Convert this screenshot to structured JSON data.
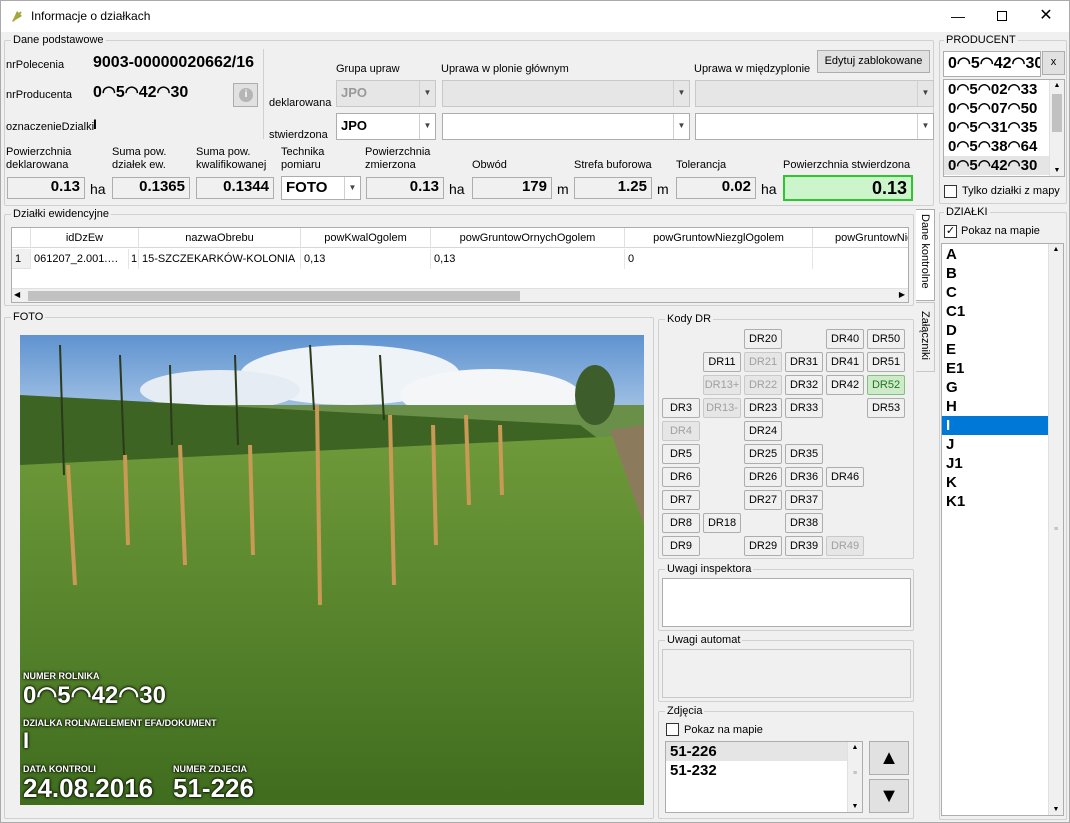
{
  "window": {
    "title": "Informacje o działkach"
  },
  "dane": {
    "title": "Dane podstawowe",
    "nrPolecenia_label": "nrPolecenia",
    "nrPolecenia": "9003-00000020662/16",
    "nrProducenta_label": "nrProducenta",
    "nrProducenta": "0◠5◠42◠30",
    "oznaczenie_label": "oznaczenieDzialki",
    "oznaczenie": "I",
    "grupa_upraw": "Grupa upraw",
    "uprawa_glowna": "Uprawa w plonie głównym",
    "uprawa_miedzy": "Uprawa w międzyplonie",
    "edit_btn": "Edytuj zablokowane",
    "deklarowana": "deklarowana",
    "stwierdzona": "stwierdzona",
    "grupa_dekl": "JPO",
    "grupa_stw": "JPO"
  },
  "measures": {
    "pow_dekl_label": "Powierzchnia deklarowana",
    "pow_dekl": "0.13",
    "suma_ew_label": "Suma pow. działek ew.",
    "suma_ew": "0.1365",
    "suma_kwal_label": "Suma pow. kwalifikowanej",
    "suma_kwal": "0.1344",
    "technika_label": "Technika pomiaru",
    "technika": "FOTO",
    "pow_zm_label": "Powierzchnia zmierzona",
    "pow_zm": "0.13",
    "obwod_label": "Obwód",
    "obwod": "179",
    "strefa_label": "Strefa buforowa",
    "strefa": "1.25",
    "toler_label": "Tolerancja",
    "toler": "0.02",
    "pow_stw_label": "Powierzchnia stwierdzona",
    "pow_stw": "0.13",
    "unit_ha": "ha",
    "unit_m": "m"
  },
  "producent": {
    "title": "PRODUCENT",
    "search": "0◠5◠42◠30",
    "clear": "x",
    "items": [
      "0◠5◠02◠33",
      "0◠5◠07◠50",
      "0◠5◠31◠35",
      "0◠5◠38◠64",
      "0◠5◠42◠30"
    ],
    "only_map": "Tylko działki z mapy"
  },
  "dzialki": {
    "title": "DZIAŁKI",
    "show_map": "Pokaz na mapie",
    "items": [
      "A",
      "B",
      "C",
      "C1",
      "D",
      "E",
      "E1",
      "G",
      "H",
      "I",
      "J",
      "J1",
      "K",
      "K1"
    ],
    "selected_index": 9
  },
  "ewid": {
    "title": "Działki ewidencyjne",
    "columns": [
      "idDzEw",
      "nazwaObrebu",
      "powKwalOgolem",
      "powGruntowOrnychOgolem",
      "powGruntowNiezglOgolem",
      "powGruntowNie"
    ],
    "row": {
      "num": "1",
      "id": "061207_2.001.…",
      "num2": "1",
      "obreb": "15-SZCZEKARKÓW-KOLONIA",
      "kwal": "0,13",
      "orne": "0,13",
      "niezgl": "0"
    },
    "tab1": "Dane kontrolne",
    "tab2": "Załączniki"
  },
  "foto": {
    "title": "FOTO",
    "lbl_rolnik": "NUMER ROLNIKA",
    "rolnik": "0◠5◠42◠30",
    "lbl_dzialka": "DZIALKA ROLNA/ELEMENT EFA/DOKUMENT",
    "dzialka": "I",
    "lbl_data": "DATA KONTROLI",
    "data": "24.08.2016",
    "lbl_zdj": "NUMER ZDJECIA",
    "zdj": "51-226"
  },
  "kody": {
    "title": "Kody DR",
    "buttons": {
      "DR20": "DR20",
      "DR40": "DR40",
      "DR50": "DR50",
      "DR11": "DR11",
      "DR21": "DR21",
      "DR31": "DR31",
      "DR41": "DR41",
      "DR51": "DR51",
      "DR13p": "DR13+",
      "DR22": "DR22",
      "DR32": "DR32",
      "DR42": "DR42",
      "DR52": "DR52",
      "DR3": "DR3",
      "DR13m": "DR13-",
      "DR23": "DR23",
      "DR33": "DR33",
      "DR53": "DR53",
      "DR4": "DR4",
      "DR24": "DR24",
      "DR5": "DR5",
      "DR25": "DR25",
      "DR35": "DR35",
      "DR6": "DR6",
      "DR26": "DR26",
      "DR36": "DR36",
      "DR46": "DR46",
      "DR7": "DR7",
      "DR27": "DR27",
      "DR37": "DR37",
      "DR8": "DR8",
      "DR18": "DR18",
      "DR38": "DR38",
      "DR9": "DR9",
      "DR29": "DR29",
      "DR39": "DR39",
      "DR49": "DR49"
    }
  },
  "uwagi": {
    "inspektora": "Uwagi inspektora",
    "automat": "Uwagi automat"
  },
  "zdjecia": {
    "title": "Zdjęcia",
    "show_map": "Pokaz na mapie",
    "items": [
      "51-226",
      "51-232"
    ]
  },
  "colors": {
    "accent": "#0078d7",
    "stw_bg": "#ccf5cc",
    "stw_border": "#2ec62e"
  }
}
